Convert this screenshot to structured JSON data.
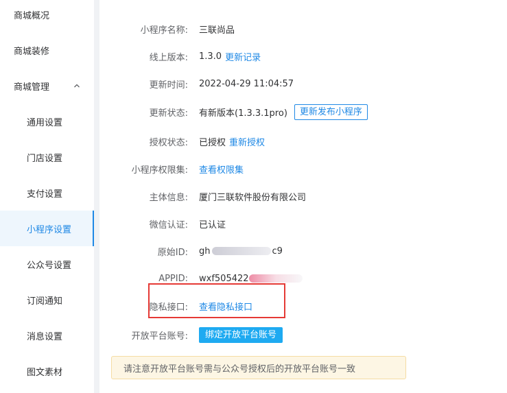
{
  "sidebar": {
    "items": [
      {
        "label": "商城概况"
      },
      {
        "label": "商城装修"
      },
      {
        "label": "商城管理"
      },
      {
        "label": "通用设置"
      },
      {
        "label": "门店设置"
      },
      {
        "label": "支付设置"
      },
      {
        "label": "小程序设置"
      },
      {
        "label": "公众号设置"
      },
      {
        "label": "订阅通知"
      },
      {
        "label": "消息设置"
      },
      {
        "label": "图文素材"
      }
    ]
  },
  "info": {
    "name_label": "小程序名称:",
    "name_value": "三联尚品",
    "version_label": "线上版本:",
    "version_value": "1.3.0",
    "version_link": "更新记录",
    "update_time_label": "更新时间:",
    "update_time_value": "2022-04-29 11:04:57",
    "update_status_label": "更新状态:",
    "update_status_value": "有新版本(1.3.3.1pro)",
    "publish_button": "更新发布小程序",
    "auth_label": "授权状态:",
    "auth_value": "已授权",
    "reauth_link": "重新授权",
    "perm_label": "小程序权限集:",
    "perm_link": "查看权限集",
    "entity_label": "主体信息:",
    "entity_value": "厦门三联软件股份有限公司",
    "wechat_label": "微信认证:",
    "wechat_value": "已认证",
    "origin_label": "原始ID:",
    "origin_prefix": "g",
    "origin_middle": "h",
    "origin_suffix": "c9",
    "appid_label": "APPID:",
    "appid_value": "wxf505422",
    "privacy_label": "隐私接口:",
    "privacy_link": "查看隐私接口",
    "platform_label": "开放平台账号:",
    "platform_button": "绑定开放平台账号"
  },
  "notice": {
    "text": "请注意开放平台账号需与公众号授权后的开放平台账号一致"
  },
  "colors": {
    "accent": "#1e88e5",
    "button": "#1eaaf1",
    "highlight": "#e53935",
    "notice_bg": "#fdf6e4"
  }
}
